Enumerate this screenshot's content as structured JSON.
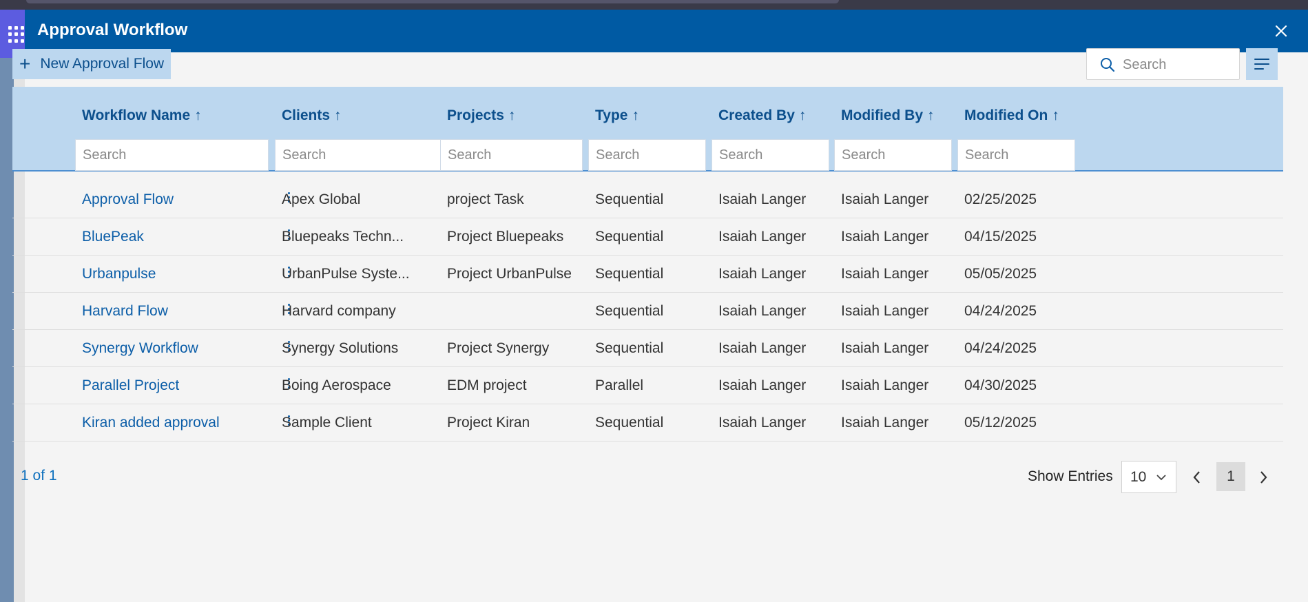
{
  "dialog": {
    "title": "Approval Workflow",
    "close_icon": "close-icon"
  },
  "toolbar": {
    "new_button_label": "New Approval Flow",
    "new_icon": "plus-icon",
    "search_placeholder": "Search",
    "menu_icon": "column-options-icon"
  },
  "columns": [
    {
      "key": "name",
      "label": "Workflow Name",
      "sort": "↑",
      "filter_placeholder": "Search"
    },
    {
      "key": "client",
      "label": "Clients",
      "sort": "↑",
      "filter_placeholder": "Search"
    },
    {
      "key": "project",
      "label": "Projects",
      "sort": "↑",
      "filter_placeholder": "Search"
    },
    {
      "key": "type",
      "label": "Type",
      "sort": "↑",
      "filter_placeholder": "Search"
    },
    {
      "key": "created_by",
      "label": "Created By",
      "sort": "↑",
      "filter_placeholder": "Search"
    },
    {
      "key": "modified_by",
      "label": "Modified By",
      "sort": "↑",
      "filter_placeholder": "Search"
    },
    {
      "key": "modified_on",
      "label": "Modified On",
      "sort": "↑",
      "filter_placeholder": "Search"
    }
  ],
  "rows": [
    {
      "name": "Approval Flow",
      "client": "Apex Global",
      "project": "project Task",
      "type": "Sequential",
      "created_by": "Isaiah Langer",
      "modified_by": "Isaiah Langer",
      "modified_on": "02/25/2025"
    },
    {
      "name": "BluePeak",
      "client": "Bluepeaks Techn...",
      "project": "Project Bluepeaks",
      "type": "Sequential",
      "created_by": "Isaiah Langer",
      "modified_by": "Isaiah Langer",
      "modified_on": "04/15/2025"
    },
    {
      "name": "Urbanpulse",
      "client": "UrbanPulse Syste...",
      "project": "Project UrbanPulse",
      "type": "Sequential",
      "created_by": "Isaiah Langer",
      "modified_by": "Isaiah Langer",
      "modified_on": "05/05/2025"
    },
    {
      "name": "Harvard Flow",
      "client": "Harvard company",
      "project": "",
      "type": "Sequential",
      "created_by": "Isaiah Langer",
      "modified_by": "Isaiah Langer",
      "modified_on": "04/24/2025"
    },
    {
      "name": "Synergy Workflow",
      "client": "Synergy Solutions",
      "project": "Project Synergy",
      "type": "Sequential",
      "created_by": "Isaiah Langer",
      "modified_by": "Isaiah Langer",
      "modified_on": "04/24/2025"
    },
    {
      "name": "Parallel Project",
      "client": "Boing Aerospace",
      "project": "EDM project",
      "type": "Parallel",
      "created_by": "Isaiah Langer",
      "modified_by": "Isaiah Langer",
      "modified_on": "04/30/2025"
    },
    {
      "name": "Kiran added approval",
      "client": "Sample Client",
      "project": "Project Kiran",
      "type": "Sequential",
      "created_by": "Isaiah Langer",
      "modified_by": "Isaiah Langer",
      "modified_on": "05/12/2025"
    }
  ],
  "pagination": {
    "info": "1 of 1",
    "show_entries_label": "Show Entries",
    "entries_value": "10",
    "current_page": "1",
    "prev_icon": "chevron-left-icon",
    "next_icon": "chevron-right-icon"
  },
  "colors": {
    "header": "#005aa3",
    "accent_light": "#bcd7ef",
    "link": "#0c5ea8"
  }
}
